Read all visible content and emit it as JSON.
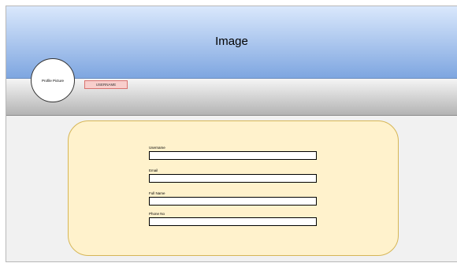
{
  "header": {
    "title": "Image"
  },
  "profile": {
    "picture_label": "Profile Picture",
    "username_badge": "USERNAME"
  },
  "form": {
    "fields": [
      {
        "label": "Username",
        "value": ""
      },
      {
        "label": "Email",
        "value": ""
      },
      {
        "label": "Full Name",
        "value": ""
      },
      {
        "label": "Phone No",
        "value": ""
      }
    ]
  },
  "colors": {
    "banner_top": "#dae8fc",
    "banner_bottom": "#7ea6e0",
    "badge_fill": "#f8cecc",
    "card_fill": "#fff2cc",
    "card_border": "#d6b656"
  }
}
